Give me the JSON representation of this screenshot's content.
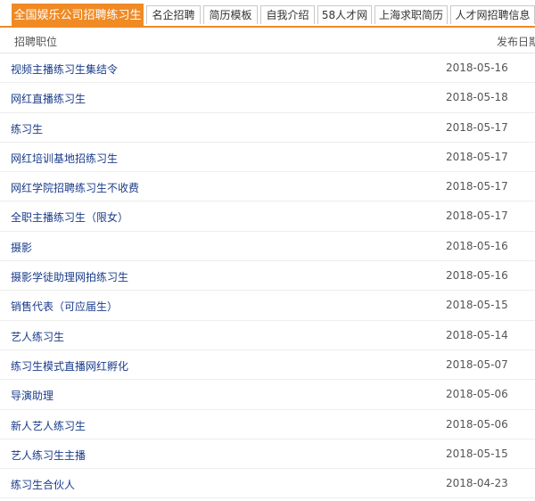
{
  "tabs": [
    {
      "label": "全国娱乐公司招聘练习生",
      "active": true
    },
    {
      "label": "名企招聘",
      "active": false
    },
    {
      "label": "简历模板",
      "active": false
    },
    {
      "label": "自我介绍",
      "active": false
    },
    {
      "label": "58人才网",
      "active": false
    },
    {
      "label": "上海求职简历",
      "active": false
    },
    {
      "label": "人才网招聘信息",
      "active": false
    }
  ],
  "table": {
    "col_title": "招聘职位",
    "col_date": "发布日期",
    "rows": [
      {
        "title": "视频主播练习生集结令",
        "date": "2018-05-16"
      },
      {
        "title": "网红直播练习生",
        "date": "2018-05-18"
      },
      {
        "title": "练习生",
        "date": "2018-05-17"
      },
      {
        "title": "网红培训基地招练习生",
        "date": "2018-05-17"
      },
      {
        "title": "网红学院招聘练习生不收费",
        "date": "2018-05-17"
      },
      {
        "title": "全职主播练习生（限女）",
        "date": "2018-05-17"
      },
      {
        "title": "摄影",
        "date": "2018-05-16"
      },
      {
        "title": "摄影学徒助理网拍练习生",
        "date": "2018-05-16"
      },
      {
        "title": "销售代表（可应届生）",
        "date": "2018-05-15"
      },
      {
        "title": "艺人练习生",
        "date": "2018-05-14"
      },
      {
        "title": "练习生模式直播网红孵化",
        "date": "2018-05-07"
      },
      {
        "title": "导演助理",
        "date": "2018-05-06"
      },
      {
        "title": "新人艺人练习生",
        "date": "2018-05-06"
      },
      {
        "title": "艺人练习生主播",
        "date": "2018-05-15"
      },
      {
        "title": "练习生合伙人",
        "date": "2018-04-23"
      }
    ]
  },
  "colors": {
    "accent": "#f08a24",
    "link": "#1a3c8a"
  }
}
